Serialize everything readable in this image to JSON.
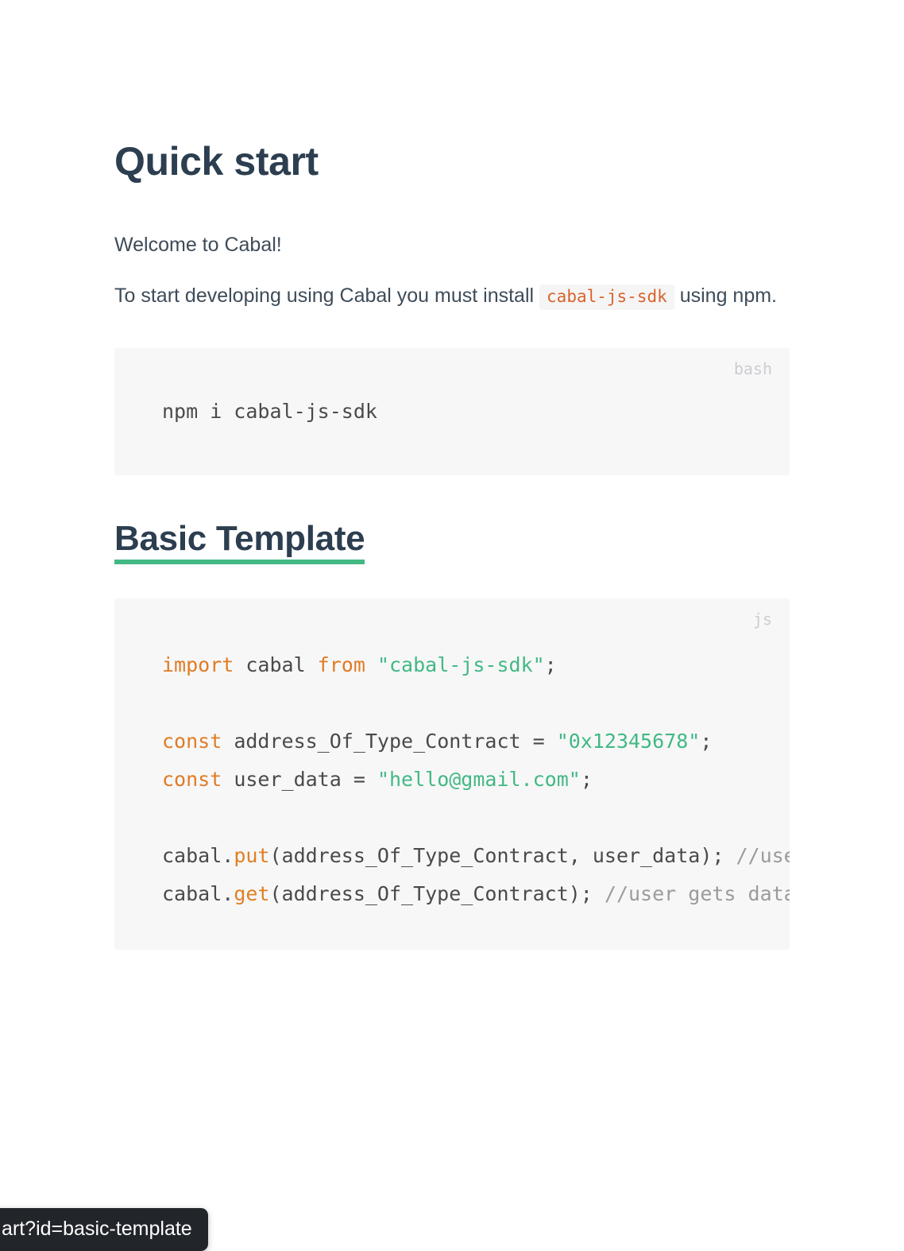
{
  "page": {
    "title": "Quick start",
    "intro": "Welcome to Cabal!",
    "install_text_before": "To start developing using Cabal you must install",
    "install_inline_code": "cabal-js-sdk",
    "install_text_after": "using npm."
  },
  "bash_block": {
    "lang_label": "bash",
    "code": "npm i cabal-js-sdk"
  },
  "section": {
    "heading": "Basic Template",
    "heading_link_color": "#2c3e50",
    "heading_underline_color": "#42b983"
  },
  "js_block": {
    "lang_label": "js",
    "lines": [
      {
        "tokens": [
          {
            "text": "import",
            "type": "keyword"
          },
          {
            "text": " cabal ",
            "type": "plain"
          },
          {
            "text": "from",
            "type": "keyword"
          },
          {
            "text": " ",
            "type": "plain"
          },
          {
            "text": "\"cabal-js-sdk\"",
            "type": "string"
          },
          {
            "text": ";",
            "type": "plain"
          }
        ]
      },
      {
        "tokens": []
      },
      {
        "tokens": [
          {
            "text": "const",
            "type": "keyword"
          },
          {
            "text": " address_Of_Type_Contract = ",
            "type": "plain"
          },
          {
            "text": "\"0x12345678\"",
            "type": "string"
          },
          {
            "text": ";",
            "type": "plain"
          }
        ]
      },
      {
        "tokens": [
          {
            "text": "const",
            "type": "keyword"
          },
          {
            "text": " user_data = ",
            "type": "plain"
          },
          {
            "text": "\"hello@gmail.com\"",
            "type": "string"
          },
          {
            "text": ";",
            "type": "plain"
          }
        ]
      },
      {
        "tokens": []
      },
      {
        "tokens": [
          {
            "text": "cabal.",
            "type": "plain"
          },
          {
            "text": "put",
            "type": "function"
          },
          {
            "text": "(address_Of_Type_Contract, user_data); ",
            "type": "plain"
          },
          {
            "text": "//user puts data",
            "type": "comment"
          }
        ]
      },
      {
        "tokens": [
          {
            "text": "cabal.",
            "type": "plain"
          },
          {
            "text": "get",
            "type": "function"
          },
          {
            "text": "(address_Of_Type_Contract); ",
            "type": "plain"
          },
          {
            "text": "//user gets data",
            "type": "comment"
          }
        ]
      }
    ]
  },
  "status_tooltip": {
    "url": "art?id=basic-template"
  },
  "colors": {
    "heading": "#2c3e50",
    "body_text": "#3e4c59",
    "inline_code_text": "#d9632a",
    "inline_code_bg": "#f5f5f5",
    "code_block_bg": "#f7f7f8",
    "keyword": "#e07c24",
    "string": "#42b983",
    "comment": "#9b9b9b",
    "accent_green": "#42b983",
    "tooltip_bg": "#22262b"
  }
}
